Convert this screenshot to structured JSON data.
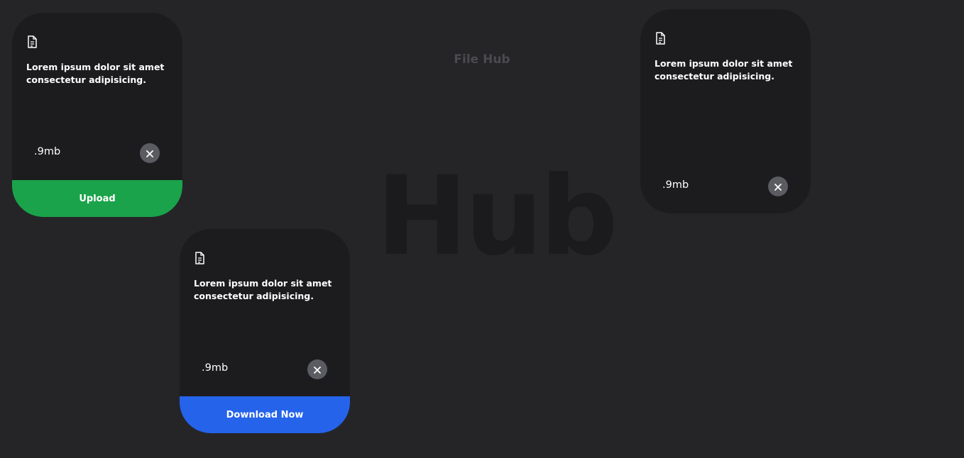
{
  "page": {
    "title": "File Hub",
    "background_word": "Hub"
  },
  "colors": {
    "background": "#252528",
    "card": "#1c1c1f",
    "upload": "#1aa34a",
    "download": "#2563eb",
    "close_button": "#5b5b62"
  },
  "cards": [
    {
      "icon": "document-icon",
      "text": "Lorem ipsum dolor sit amet consectetur adipisicing.",
      "size": ".9mb",
      "close_icon": "close-icon",
      "action_label": "Upload"
    },
    {
      "icon": "document-icon",
      "text": "Lorem ipsum dolor sit amet consectetur adipisicing.",
      "size": ".9mb",
      "close_icon": "close-icon",
      "action_label": "Download Now"
    },
    {
      "icon": "document-icon",
      "text": "Lorem ipsum dolor sit amet consectetur adipisicing.",
      "size": ".9mb",
      "close_icon": "close-icon"
    }
  ]
}
